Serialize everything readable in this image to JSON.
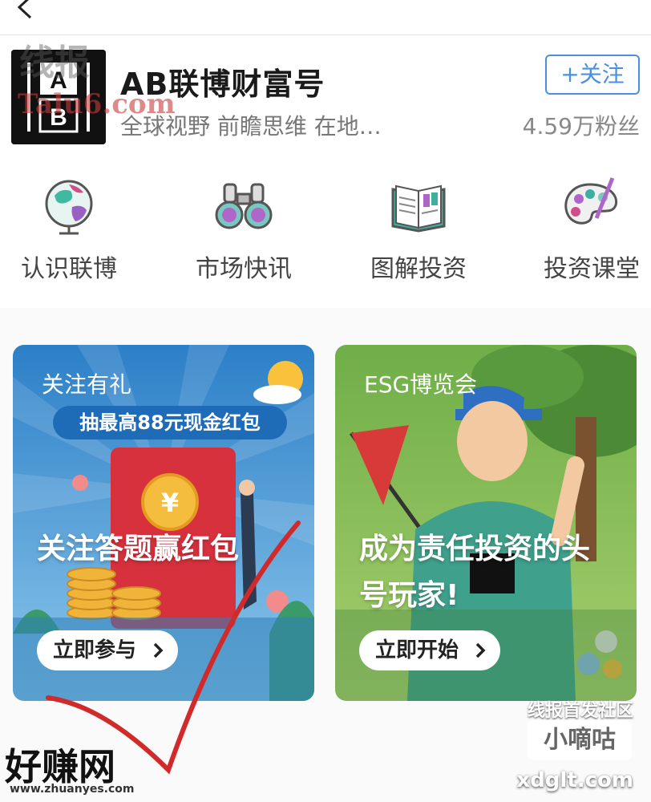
{
  "account": {
    "name": "AB联博财富号",
    "description": "全球视野 前瞻思维 在地…",
    "follow_label": "+关注",
    "fans": "4.59万粉丝",
    "logo_text_top": "A",
    "logo_text_bottom": "B"
  },
  "menu": [
    {
      "label": "认识联博",
      "icon": "globe-icon"
    },
    {
      "label": "市场快讯",
      "icon": "binoculars-icon"
    },
    {
      "label": "图解投资",
      "icon": "open-book-icon"
    },
    {
      "label": "投资课堂",
      "icon": "palette-icon"
    }
  ],
  "cards": [
    {
      "tag": "关注有礼",
      "subtitle": "抽最高88元现金红包",
      "title": "关注答题赢红包",
      "button": "立即参与"
    },
    {
      "tag": "ESG博览会",
      "title_line1": "成为责任投资的头",
      "title_line2": "号玩家!",
      "button": "立即开始"
    }
  ],
  "watermarks": {
    "top_left_1": "线报",
    "top_left_2": "Talu6.com",
    "bottom_right_1": "线报首发社区",
    "bottom_right_2": "小嘀咕",
    "bottom_right_3": "xdglt.com",
    "bottom_left_1": "好赚网",
    "bottom_left_2": "www.zhuanyes.com"
  },
  "colors": {
    "accent": "#4a90e2",
    "card1_sky": "#2f8fd3",
    "card2_sky": "#8cc35a"
  }
}
